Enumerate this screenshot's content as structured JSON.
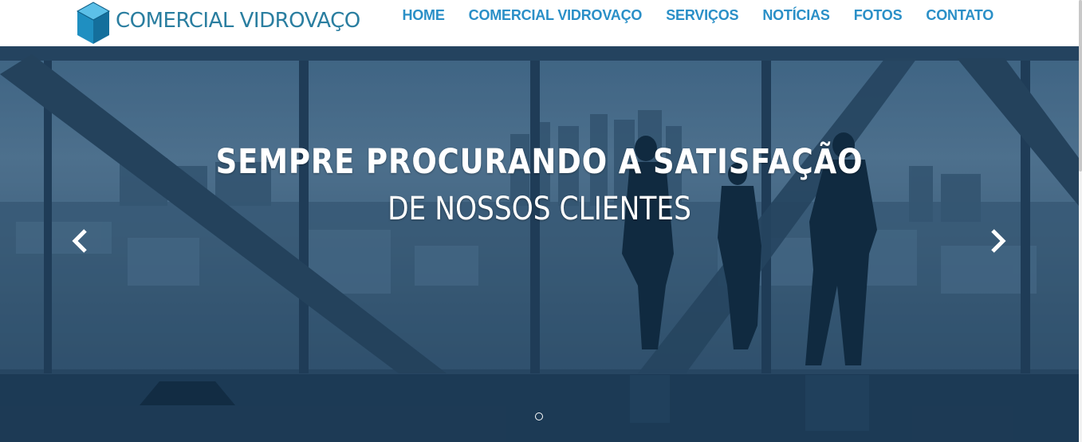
{
  "brand": {
    "name": "COMERCIAL VIDROVAÇO",
    "logo_icon": "cube-icon",
    "color": "#2a7ea0"
  },
  "nav": {
    "items": [
      {
        "label": "HOME"
      },
      {
        "label": "COMERCIAL VIDROVAÇO"
      },
      {
        "label": "SERVIÇOS"
      },
      {
        "label": "NOTÍCIAS"
      },
      {
        "label": "FOTOS"
      },
      {
        "label": "CONTATO"
      }
    ],
    "color": "#2a8fc7"
  },
  "hero": {
    "headline": "SEMPRE PROCURANDO A SATISFAÇÃO",
    "subheadline": "DE NOSSOS CLIENTES",
    "prev_icon": "chevron-left-icon",
    "next_icon": "chevron-right-icon",
    "slide_count": 1,
    "active_slide": 1
  }
}
